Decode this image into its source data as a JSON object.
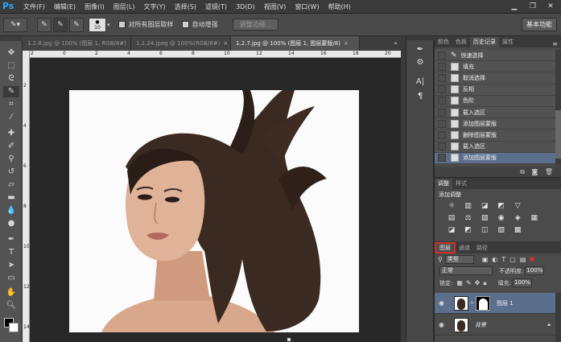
{
  "app": {
    "logo": "Ps"
  },
  "menu": [
    "文件(F)",
    "编辑(E)",
    "图像(I)",
    "图层(L)",
    "文字(Y)",
    "选择(S)",
    "滤镜(T)",
    "3D(D)",
    "视图(V)",
    "窗口(W)",
    "帮助(H)"
  ],
  "window_controls": {
    "minimize": "▁",
    "restore": "❐",
    "close": "✕"
  },
  "options_bar": {
    "brush_size": "10",
    "sample_all_layers": "对所有图层取样",
    "auto_enhance": "自动增强",
    "refine_edge": "调整边缘...",
    "workspace": "基本功能"
  },
  "doc_tabs": [
    {
      "label": "1.2.8.jpg @ 100% (图层 1, RGB/8#)",
      "close": "×"
    },
    {
      "label": "1.1.24.jpeg @ 100%(RGB/8#)",
      "close": "×"
    },
    {
      "label": "1.2.7.jpg @ 100% (图层 1, 图层蒙版/8)",
      "close": "×",
      "active": true
    }
  ],
  "ruler_h": [
    "2",
    "0",
    "2",
    "4",
    "6",
    "8",
    "10",
    "12",
    "14",
    "16",
    "18",
    "20"
  ],
  "ruler_v": [
    "2",
    "4",
    "6",
    "8",
    "10",
    "12",
    "14"
  ],
  "history_panel": {
    "tabs": [
      "颜色",
      "色板",
      "历史记录",
      "属性"
    ],
    "active_tab": "历史记录",
    "items": [
      "快速选择",
      "填充",
      "取消选择",
      "反相",
      "色阶",
      "载入选区",
      "添加图层蒙版",
      "删除图层蒙版",
      "载入选区",
      "添加图层蒙版"
    ],
    "selected_index": 9
  },
  "adjust_panel": {
    "tabs": [
      "调整",
      "样式"
    ],
    "title": "添加调整",
    "row1": [
      "☼",
      "▥",
      "◪",
      "◩",
      "▽"
    ],
    "row2": [
      "▤",
      "⚖",
      "▧",
      "◉",
      "◈",
      "▦"
    ],
    "row3": [
      "◪",
      "◩",
      "◫",
      "▨",
      "▩"
    ]
  },
  "layers_panel": {
    "tabs": [
      "图层",
      "通道",
      "路径"
    ],
    "active_tab": "图层",
    "filter": "类型",
    "blend_mode": "正常",
    "opacity_label": "不透明度:",
    "opacity_value": "100%",
    "lock_label": "锁定:",
    "fill_label": "填充:",
    "fill_value": "100%",
    "layers": [
      {
        "name": "图层 1",
        "selected": true
      },
      {
        "name": "背景",
        "locked": true
      }
    ]
  },
  "colors": {
    "accent_red": "#d0302a",
    "selection_blue": "#5b6e8c",
    "ps_blue": "#32a8f7"
  }
}
